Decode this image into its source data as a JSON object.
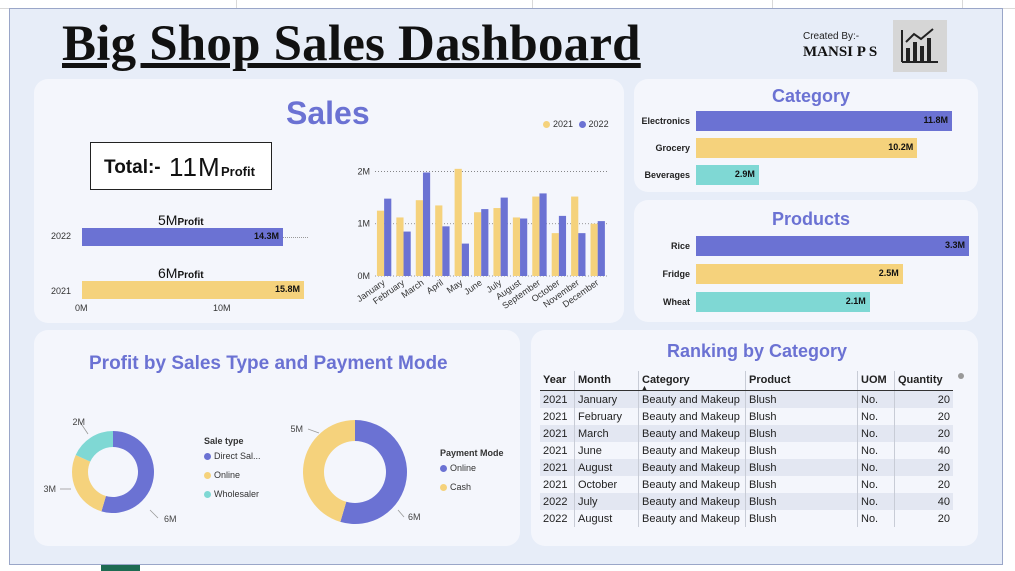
{
  "header": {
    "title": "Big Shop Sales Dashboard",
    "created_by_label": "Created By:-",
    "created_by_name": "MANSI P S",
    "logo_icon": "bar-chart-icon"
  },
  "sales": {
    "title": "Sales",
    "total_prefix": "Total:-",
    "total_value": "11M",
    "total_suffix": "Profit",
    "legend": [
      "2021",
      "2022"
    ],
    "profit_bars": [
      {
        "year": "2022",
        "profit_value": "5M",
        "profit_label": "Profit",
        "sales_label": "14.3M",
        "sales": 14.3,
        "color": "#6b72d3"
      },
      {
        "year": "2021",
        "profit_value": "6M",
        "profit_label": "Profit",
        "sales_label": "15.8M",
        "sales": 15.8,
        "color": "#f5d27c"
      }
    ],
    "profit_axis_ticks": [
      "0M",
      "10M"
    ]
  },
  "chart_data": [
    {
      "type": "bar",
      "categories": [
        "January",
        "February",
        "March",
        "April",
        "May",
        "June",
        "July",
        "August",
        "September",
        "October",
        "November",
        "December"
      ],
      "series": [
        {
          "name": "2021",
          "color": "#f5d27c",
          "values": [
            1.25,
            1.12,
            1.45,
            1.35,
            2.05,
            1.22,
            1.3,
            1.12,
            1.52,
            0.82,
            1.52,
            1.0
          ]
        },
        {
          "name": "2022",
          "color": "#6b72d3",
          "values": [
            1.48,
            0.85,
            1.98,
            0.95,
            0.62,
            1.28,
            1.5,
            1.1,
            1.58,
            1.15,
            0.82,
            1.05
          ]
        }
      ],
      "ylim": [
        0,
        2.2
      ],
      "yticks": [
        "0M",
        "1M",
        "2M"
      ],
      "ytick_values": [
        0,
        1,
        2
      ]
    }
  ],
  "category": {
    "title": "Category",
    "items": [
      {
        "label": "Electronics",
        "value_label": "11.8M",
        "value": 11.8,
        "color": "#6b72d3"
      },
      {
        "label": "Grocery",
        "value_label": "10.2M",
        "value": 10.2,
        "color": "#f5d27c"
      },
      {
        "label": "Beverages",
        "value_label": "2.9M",
        "value": 2.9,
        "color": "#7fd8d4"
      }
    ]
  },
  "products": {
    "title": "Products",
    "items": [
      {
        "label": "Rice",
        "value_label": "3.3M",
        "value": 3.3,
        "color": "#6b72d3"
      },
      {
        "label": "Fridge",
        "value_label": "2.5M",
        "value": 2.5,
        "color": "#f5d27c"
      },
      {
        "label": "Wheat",
        "value_label": "2.1M",
        "value": 2.1,
        "color": "#7fd8d4"
      }
    ]
  },
  "profit_donuts": {
    "title": "Profit by Sales Type and Payment Mode",
    "sale_type": {
      "legend_title": "Sale type",
      "slices": [
        {
          "label": "Direct Sal...",
          "value": 6,
          "value_label": "6M",
          "color": "#6b72d3"
        },
        {
          "label": "Online",
          "value": 3,
          "value_label": "3M",
          "color": "#f5d27c"
        },
        {
          "label": "Wholesaler",
          "value": 2,
          "value_label": "2M",
          "color": "#7fd8d4"
        }
      ]
    },
    "payment_mode": {
      "legend_title": "Payment Mode",
      "slices": [
        {
          "label": "Online",
          "value": 6,
          "value_label": "6M",
          "color": "#6b72d3"
        },
        {
          "label": "Cash",
          "value": 5,
          "value_label": "5M",
          "color": "#f5d27c"
        }
      ]
    }
  },
  "ranking": {
    "title": "Ranking by Category",
    "columns": [
      "Year",
      "Month",
      "Category",
      "Product",
      "UOM",
      "Quantity"
    ],
    "rows": [
      [
        "2021",
        "January",
        "Beauty and Makeup",
        "Blush",
        "No.",
        "20"
      ],
      [
        "2021",
        "February",
        "Beauty and Makeup",
        "Blush",
        "No.",
        "20"
      ],
      [
        "2021",
        "March",
        "Beauty and Makeup",
        "Blush",
        "No.",
        "20"
      ],
      [
        "2021",
        "June",
        "Beauty and Makeup",
        "Blush",
        "No.",
        "40"
      ],
      [
        "2021",
        "August",
        "Beauty and Makeup",
        "Blush",
        "No.",
        "20"
      ],
      [
        "2021",
        "October",
        "Beauty and Makeup",
        "Blush",
        "No.",
        "20"
      ],
      [
        "2022",
        "July",
        "Beauty and Makeup",
        "Blush",
        "No.",
        "40"
      ],
      [
        "2022",
        "August",
        "Beauty and Makeup",
        "Blush",
        "No.",
        "20"
      ]
    ]
  }
}
